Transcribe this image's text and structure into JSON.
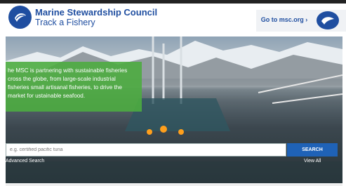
{
  "header": {
    "title": "Marine Stewardship Council",
    "subtitle": "Track a Fishery",
    "goto_label": "Go to msc.org ›"
  },
  "hero": {
    "overlay_text": "he MSC is partnering with sustainable fisheries cross the globe, from large-scale industrial fisheries small artisanal fisheries, to drive the market for ustainable seafood.",
    "search_placeholder": "e.g. certified pacific tuna",
    "search_button_label": "SEARCH",
    "advanced_label": "Advanced Search",
    "view_all_label": "View All"
  },
  "colors": {
    "brand_blue": "#1f4ea0",
    "accent_green": "#4dac40",
    "button_blue": "#1f62b7"
  },
  "icons": {
    "logo": "fish-logo-icon",
    "seal": "msc-ecolabel-icon"
  }
}
